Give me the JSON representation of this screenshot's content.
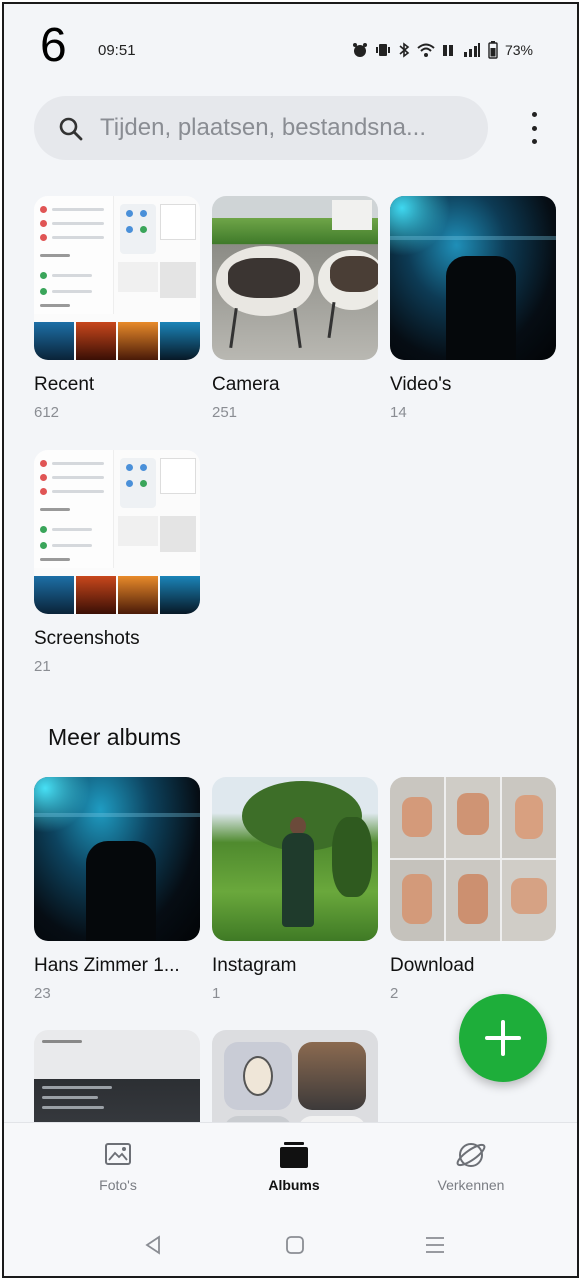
{
  "step_number": "6",
  "status_bar": {
    "time": "09:51",
    "battery": "73%"
  },
  "search": {
    "placeholder": "Tijden, plaatsen, bestandsna..."
  },
  "albums": [
    {
      "name": "Recent",
      "count": "612"
    },
    {
      "name": "Camera",
      "count": "251"
    },
    {
      "name": "Video's",
      "count": "14"
    },
    {
      "name": "Screenshots",
      "count": "21"
    }
  ],
  "more_albums": {
    "title": "Meer albums",
    "items": [
      {
        "name": "Hans Zimmer 1...",
        "count": "23"
      },
      {
        "name": "Instagram",
        "count": "1"
      },
      {
        "name": "Download",
        "count": "2"
      }
    ]
  },
  "bottom_nav": {
    "items": [
      {
        "label": "Foto's",
        "icon": "photos-icon"
      },
      {
        "label": "Albums",
        "icon": "albums-icon"
      },
      {
        "label": "Verkennen",
        "icon": "explore-icon"
      }
    ],
    "active": "Albums"
  },
  "colors": {
    "background": "#f3f5f8",
    "fab": "#1eae3a",
    "search_bg": "#e6e8ec"
  }
}
